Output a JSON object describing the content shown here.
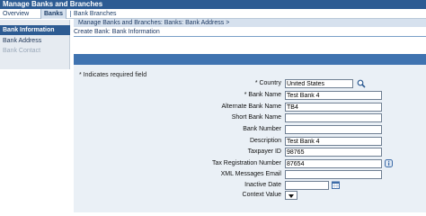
{
  "app": {
    "title": "Manage Banks and Branches"
  },
  "tabs": [
    {
      "label": "Overview"
    },
    {
      "label": "Banks"
    },
    {
      "label": "Bank Branches"
    }
  ],
  "sidebar": {
    "header": "Bank Information",
    "items": [
      {
        "label": "Bank Address"
      },
      {
        "label": "Bank Contact"
      }
    ]
  },
  "breadcrumb": "Manage Banks and Branches: Banks: Bank Address  >",
  "page": {
    "title": "Create Bank: Bank Information",
    "required_note": "*  Indicates required field"
  },
  "form": {
    "fields": [
      {
        "label": "*  Country",
        "value": "United States"
      },
      {
        "label": "*  Bank Name",
        "value": "Test Bank 4"
      },
      {
        "label": "Alternate Bank Name",
        "value": "TB4"
      },
      {
        "label": "Short Bank Name",
        "value": ""
      },
      {
        "label": "Bank Number",
        "value": ""
      },
      {
        "label": "Description",
        "value": "Test Bank 4"
      },
      {
        "label": "Taxpayer ID",
        "value": "98765"
      },
      {
        "label": "Tax Registration Number",
        "value": "87654"
      },
      {
        "label": "XML Messages Email",
        "value": ""
      },
      {
        "label": "Inactive Date",
        "value": ""
      },
      {
        "label": "Context Value",
        "value": ""
      }
    ]
  },
  "icons": {
    "lov": "search-flashlight-icon",
    "tip": "info-tip-icon",
    "calendar": "calendar-icon",
    "dropdown": "chevron-down-icon"
  },
  "colors": {
    "header": "#2c5b93",
    "band": "#3f73b0",
    "content_bg": "#eaf0f6",
    "active_tab": "#d6e1ee"
  }
}
